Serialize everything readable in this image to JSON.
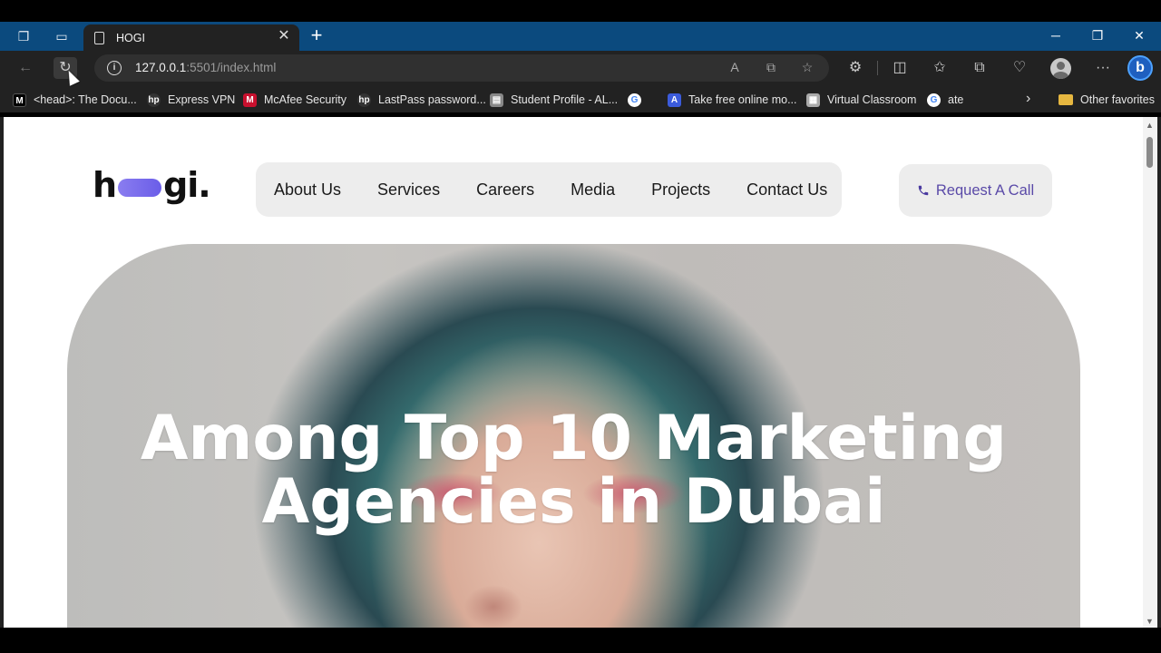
{
  "browser": {
    "tab_title": "HOGI",
    "url_host": "127.0.0.1",
    "url_rest": ":5501/index.html",
    "bookmarks": [
      {
        "label": "<head>: The Docu...",
        "icon": "mdn-icon",
        "color": "#000000"
      },
      {
        "label": "Express VPN",
        "icon": "hp-icon",
        "color": "#333333"
      },
      {
        "label": "McAfee Security",
        "icon": "mcafee-icon",
        "color": "#c8102e"
      },
      {
        "label": "LastPass password...",
        "icon": "hp-icon",
        "color": "#333333"
      },
      {
        "label": "Student Profile - AL...",
        "icon": "profile-icon",
        "color": "#888888"
      },
      {
        "label": "",
        "icon": "google-icon",
        "color": "#ffffff"
      },
      {
        "label": "Take free online mo...",
        "icon": "course-icon",
        "color": "#3b5bdb"
      },
      {
        "label": "Virtual Classroom",
        "icon": "classroom-icon",
        "color": "#aaaaaa"
      },
      {
        "label": "ate",
        "icon": "google-icon",
        "color": "#ffffff"
      }
    ],
    "other_favorites": "Other favorites"
  },
  "site": {
    "logo_left": "h",
    "logo_right": "gi.",
    "nav": [
      "About Us",
      "Services",
      "Careers",
      "Media",
      "Projects",
      "Contact Us"
    ],
    "cta_label": "Request A Call",
    "hero_line1": "Among Top 10 Marketing",
    "hero_line2": "Agencies in Dubai"
  },
  "colors": {
    "accent": "#5a4aa8",
    "logo_pill": "#7b6ef0",
    "nav_bg": "#ededed"
  }
}
